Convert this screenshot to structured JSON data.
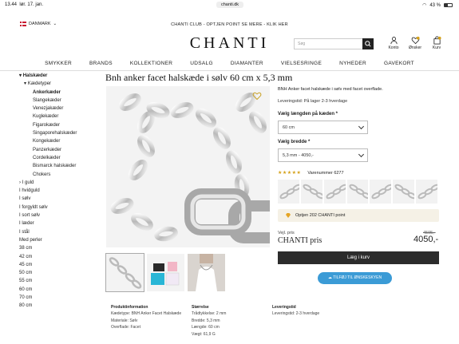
{
  "status": {
    "time": "13.44",
    "date": "lør. 17. jan.",
    "url": "chanti.dk",
    "battery": "43 %",
    "battery_level": 0.43
  },
  "topbar": {
    "country": "DANMARK",
    "promo": "CHANTI CLUB - OPTJEN POINT SE MERE - KLIK HER"
  },
  "header": {
    "logo": "CHANTI",
    "search_placeholder": "Søg",
    "icons": [
      {
        "label": "Konto",
        "icon": "user-icon"
      },
      {
        "label": "Ønsker",
        "icon": "heart-icon"
      },
      {
        "label": "Kurv",
        "icon": "bag-icon"
      }
    ]
  },
  "nav": [
    "SMYKKER",
    "BRANDS",
    "KOLLEKTIONER",
    "UDSALG",
    "DIAMANTER",
    "VIELSESRINGE",
    "NYHEDER",
    "GAVEKORT"
  ],
  "sidebar": [
    {
      "label": "Halskæder",
      "level": "l1",
      "arrow": "▾",
      "bold": true
    },
    {
      "label": "Kædetyper",
      "level": "l2",
      "arrow": "▾",
      "bold": false
    },
    {
      "label": "Ankerkæder",
      "level": "l3",
      "arrow": "",
      "bold": true
    },
    {
      "label": "Slangekæder",
      "level": "l3",
      "arrow": "",
      "bold": false
    },
    {
      "label": "Venezjakæder",
      "level": "l3",
      "arrow": "",
      "bold": false
    },
    {
      "label": "Kuglekæder",
      "level": "l3",
      "arrow": "",
      "bold": false
    },
    {
      "label": "Figarokæder",
      "level": "l3",
      "arrow": "",
      "bold": false
    },
    {
      "label": "Singaporehalskæder",
      "level": "l3",
      "arrow": "",
      "bold": false
    },
    {
      "label": "Kongekæder",
      "level": "l3",
      "arrow": "",
      "bold": false
    },
    {
      "label": "Panzerkæder",
      "level": "l3",
      "arrow": "",
      "bold": false
    },
    {
      "label": "Cordelkæder",
      "level": "l3",
      "arrow": "",
      "bold": false
    },
    {
      "label": "Bismarck halskæder",
      "level": "l3",
      "arrow": "",
      "bold": false
    },
    {
      "label": "Chokers",
      "level": "l3",
      "arrow": "",
      "bold": false
    },
    {
      "label": "I guld",
      "level": "l1",
      "arrow": "›",
      "bold": false
    },
    {
      "label": "I hvidguld",
      "level": "l1",
      "arrow": "",
      "bold": false
    },
    {
      "label": "I sølv",
      "level": "l1",
      "arrow": "",
      "bold": false
    },
    {
      "label": "I forgyldt sølv",
      "level": "l1",
      "arrow": "",
      "bold": false
    },
    {
      "label": "I sort sølv",
      "level": "l1",
      "arrow": "",
      "bold": false
    },
    {
      "label": "I læder",
      "level": "l1",
      "arrow": "",
      "bold": false
    },
    {
      "label": "I stål",
      "level": "l1",
      "arrow": "",
      "bold": false
    },
    {
      "label": "Med perler",
      "level": "l1",
      "arrow": "",
      "bold": false
    },
    {
      "label": "38 cm",
      "level": "l1",
      "arrow": "",
      "bold": false
    },
    {
      "label": "42 cm",
      "level": "l1",
      "arrow": "",
      "bold": false
    },
    {
      "label": "45 cm",
      "level": "l1",
      "arrow": "",
      "bold": false
    },
    {
      "label": "50 cm",
      "level": "l1",
      "arrow": "",
      "bold": false
    },
    {
      "label": "55 cm",
      "level": "l1",
      "arrow": "",
      "bold": false
    },
    {
      "label": "60 cm",
      "level": "l1",
      "arrow": "",
      "bold": false
    },
    {
      "label": "70 cm",
      "level": "l1",
      "arrow": "",
      "bold": false
    },
    {
      "label": "80 cm",
      "level": "l1",
      "arrow": "",
      "bold": false
    }
  ],
  "product": {
    "title": "Bnh anker facet halskæde i sølv 60 cm x 5,3 mm",
    "description": "BNH Anker facet halskæde i sølv med facet overflade.",
    "delivery": "Leveringstid: På lager 2-3 hverdage",
    "length_label": "Vælg længden på kæden *",
    "length_value": "60 cm",
    "width_label": "Vælg bredde *",
    "width_value": "5,3 mm   -   4050,-",
    "stars": "★★★★★",
    "variant_number": "Varenummer 6277",
    "points": "Optjen 202 CHANTI point",
    "vejl_label": "Vejl. pris",
    "old_price": "4595,-",
    "chanti_price_label": "CHANTI pris",
    "price": "4050,-",
    "cart_button": "Læg i kurv",
    "wishlist_button": "TILFØJ TIL ØNSKESKYEN"
  },
  "info": {
    "col1": {
      "heading": "Produktinformation",
      "lines": [
        "Kædetype: BNH Anker Facet Halskæde",
        "Materiale: Sølv",
        "Overflade: Facet"
      ]
    },
    "col2": {
      "heading": "Størrelse",
      "lines": [
        "Trådtykkelse: 2 mm",
        "Bredde: 5,3 mm",
        "Længde: 60 cm",
        "Vægt: 61,9 G"
      ]
    },
    "col3": {
      "heading": "Leveringstid",
      "lines": [
        "Leveringstid: 2-3 hverdage"
      ]
    }
  }
}
